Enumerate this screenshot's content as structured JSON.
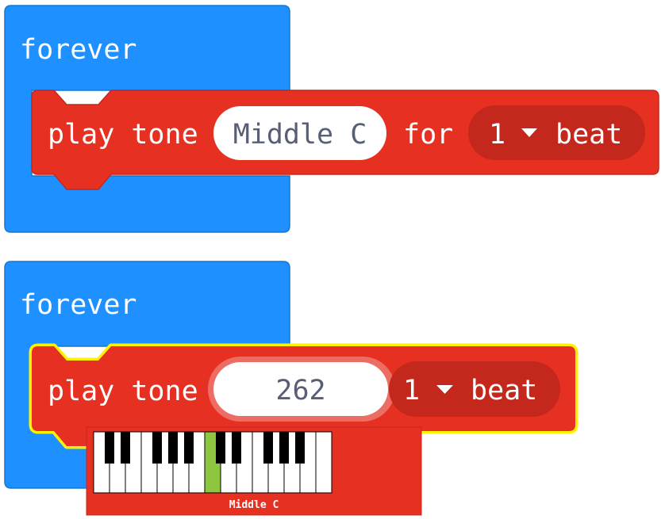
{
  "colors": {
    "forever_block": "#1e90ff",
    "play_tone_block": "#e63022",
    "play_tone_dark": "#c4281c",
    "selection_outline": "#fff200",
    "highlight_key": "#8ec63f",
    "pill_text": "#575e75"
  },
  "block1": {
    "forever_label": "forever",
    "play_tone_label": "play tone",
    "note_value": "Middle C",
    "for_label": "for",
    "beat_count": "1",
    "beat_label": "beat",
    "dropdown_icon": "caret-down-icon"
  },
  "block2": {
    "forever_label": "forever",
    "play_tone_label": "play tone",
    "note_value": "262",
    "beat_count": "1",
    "beat_label": "beat",
    "dropdown_icon": "caret-down-icon",
    "selected": true
  },
  "piano": {
    "selected_note_label": "Middle C",
    "white_key_count": 15,
    "highlighted_white_key": 7
  }
}
